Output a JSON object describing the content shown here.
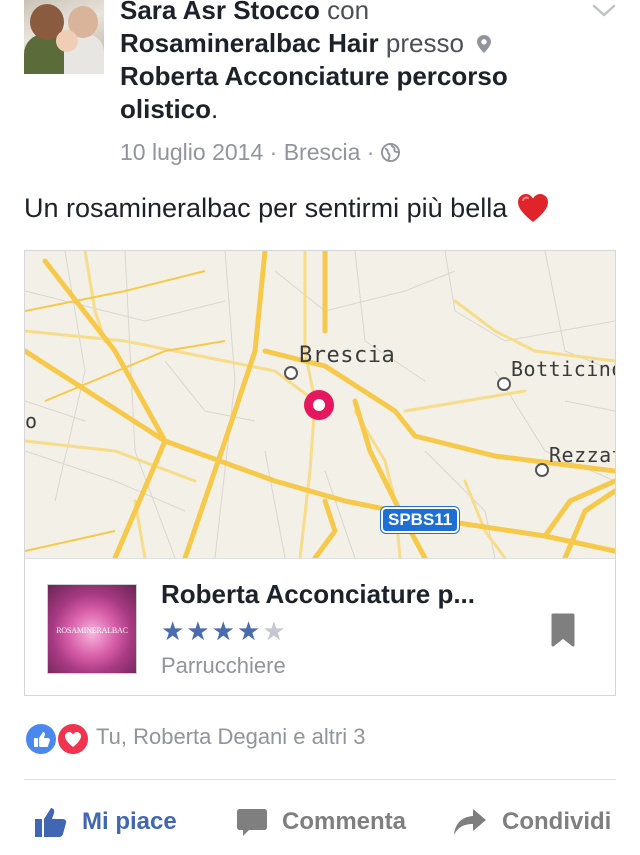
{
  "post": {
    "author": "Sara Asr Stocco",
    "with_word": "con",
    "tagged": "Rosamineralbac Hair",
    "at_word": "presso",
    "place": "Roberta Acconciature percorso olistico",
    "period": ".",
    "date": "10 luglio 2014",
    "separator": "·",
    "location": "Brescia",
    "privacy_icon": "globe-icon",
    "text": "Un rosamineralbac per sentirmi più bella",
    "emoji": "heart-emoji"
  },
  "map": {
    "labels": {
      "city": "Brescia",
      "east": "Botticino",
      "southeast": "Rezzat",
      "west": "o"
    },
    "road_shield": "SPBS11",
    "pin_color": "#e5175f"
  },
  "place_card": {
    "name": "Roberta Acconciature p...",
    "rating_stars": "★★★★",
    "rating_empty": "★",
    "rating": 4,
    "category": "Parrucchiere",
    "thumb_text": "ROSAMINERALBAC"
  },
  "reactions": {
    "summary": "Tu, Roberta Degani e altri 3",
    "types": [
      "like-icon",
      "love-icon"
    ]
  },
  "actions": {
    "like": "Mi piace",
    "comment": "Commenta",
    "share": "Condividi"
  },
  "colors": {
    "brand_blue": "#4267b2",
    "meta_gray": "#90949c",
    "map_bg": "#f3f0e8",
    "road_major": "#f7c94a"
  }
}
